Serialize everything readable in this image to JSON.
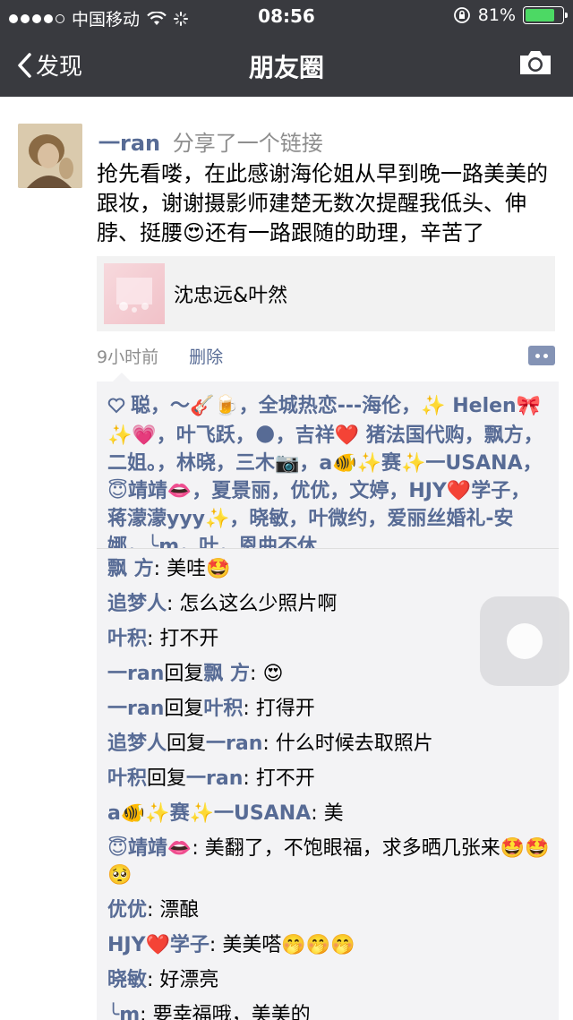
{
  "status_bar": {
    "carrier": "中国移动",
    "time": "08:56",
    "battery": "81%",
    "battery_level": 0.81
  },
  "nav": {
    "back_label": "发现",
    "title": "朋友圈"
  },
  "post": {
    "author": "一ran",
    "action": "分享了一个链接",
    "text": "抢先看喽，在此感谢海伦姐从早到晚一路美美的跟妆，谢谢摄影师建楚无数次提醒我低头、伸脖、挺腰😍还有一路跟随的助理，辛苦了",
    "link_title": "沈忠远&叶然",
    "time_ago": "9小时前",
    "delete_label": "删除"
  },
  "likes": "聪，～🎸🍺，全城热恋---海伦，✨ Helen🎀✨💗，叶飞跃，🌑，吉祥❤️ 猪法国代购，飘方，二姐。，林晓，三木📷，a🐠✨赛✨一USANA，😇靖靖👄，夏景丽，优优，文婷，HJY❤️学子，蒋濛濛yyy✨，晓敏，叶微约，爱丽丝婚礼-安娜，╰m，叶，恩曲不休",
  "comments": [
    {
      "name": "飘 方",
      "reply_to": "",
      "text": "美哇🤩"
    },
    {
      "name": "追梦人",
      "reply_to": "",
      "text": "怎么这么少照片啊"
    },
    {
      "name": "叶积",
      "reply_to": "",
      "text": "打不开"
    },
    {
      "name": "一ran",
      "reply_to": "飘 方",
      "text": "😍"
    },
    {
      "name": "一ran",
      "reply_to": "叶积",
      "text": "打得开"
    },
    {
      "name": "追梦人",
      "reply_to": "一ran",
      "text": "什么时候去取照片"
    },
    {
      "name": "叶积",
      "reply_to": "一ran",
      "text": "打不开"
    },
    {
      "name": "a🐠✨赛✨一USANA",
      "reply_to": "",
      "text": "美"
    },
    {
      "name": "😇靖靖👄",
      "reply_to": "",
      "text": "美翻了，不饱眼福，求多晒几张来🤩🤩🥺"
    },
    {
      "name": "优优",
      "reply_to": "",
      "text": "漂酿"
    },
    {
      "name": "HJY❤️学子",
      "reply_to": "",
      "text": "美美嗒🤭🤭🤭"
    },
    {
      "name": "晓敏",
      "reply_to": "",
      "text": "好漂亮"
    },
    {
      "name": "╰m",
      "reply_to": "",
      "text": "要幸福哦，美美的"
    }
  ],
  "reply_word": "回复"
}
